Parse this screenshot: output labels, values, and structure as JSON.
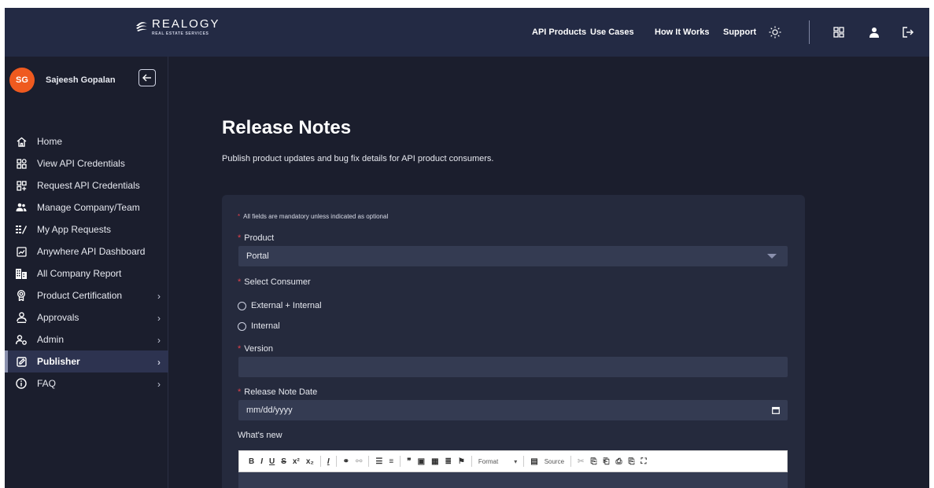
{
  "brand": {
    "name": "REALOGY",
    "sub": "REAL ESTATE SERVICES"
  },
  "nav": {
    "api_products": "API Products",
    "use_cases": "Use Cases",
    "how_it_works": "How It Works",
    "support": "Support"
  },
  "header_icons": [
    "theme-sun-icon",
    "apps-grid-icon",
    "user-icon",
    "logout-icon"
  ],
  "user": {
    "initials": "SG",
    "name": "Sajeesh Gopalan"
  },
  "sidebar": {
    "items": [
      {
        "label": "Home",
        "icon": "home-icon",
        "chevron": false
      },
      {
        "label": "View API Credentials",
        "icon": "credentials-grid-icon",
        "chevron": false
      },
      {
        "label": "Request API Credentials",
        "icon": "request-grid-icon",
        "chevron": false
      },
      {
        "label": "Manage Company/Team",
        "icon": "team-icon",
        "chevron": false
      },
      {
        "label": "My App Requests",
        "icon": "requests-icon",
        "chevron": false
      },
      {
        "label": "Anywhere API Dashboard",
        "icon": "dashboard-icon",
        "chevron": false
      },
      {
        "label": "All Company Report",
        "icon": "report-icon",
        "chevron": false
      },
      {
        "label": "Product Certification",
        "icon": "certification-icon",
        "chevron": true
      },
      {
        "label": "Approvals",
        "icon": "approvals-icon",
        "chevron": true
      },
      {
        "label": "Admin",
        "icon": "admin-icon",
        "chevron": true
      },
      {
        "label": "Publisher",
        "icon": "publisher-icon",
        "chevron": true,
        "active": true
      },
      {
        "label": "FAQ",
        "icon": "info-icon",
        "chevron": true
      }
    ]
  },
  "main": {
    "title": "Release Notes",
    "subtitle": "Publish product updates and bug fix details for API product consumers.",
    "form": {
      "mandatory_note": "All fields are mandatory unless indicated as optional",
      "product_label": "Product",
      "product_value": "Portal",
      "consumer_label": "Select Consumer",
      "consumer_options": [
        "External + Internal",
        "Internal"
      ],
      "version_label": "Version",
      "version_value": "",
      "date_label": "Release Note Date",
      "date_placeholder": "mm/dd/yyyy",
      "whats_new_label": "What's new",
      "toolbar_format": "Format",
      "toolbar_source": "Source"
    }
  },
  "colors": {
    "header_bg": "#232a44",
    "page_bg": "#1b1e2d",
    "card_bg": "#252a3d",
    "field_bg": "#343b52",
    "required": "#e0414b",
    "avatar": "#ef5a1f"
  }
}
